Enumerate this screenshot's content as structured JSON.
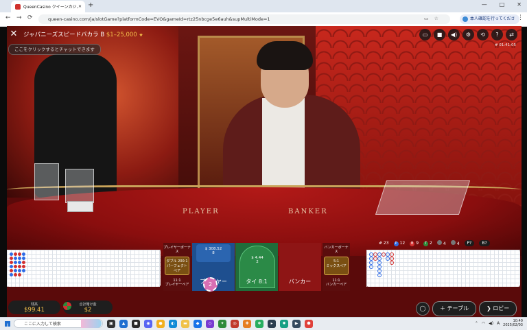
{
  "browser": {
    "tab_title": "QueenCasino クイーンカジノ |",
    "tab_close": "✕",
    "new_tab": "+",
    "url": "queen-casino.com/ja/slotGame?platformCode=EVO&gameId=rtz25nbcge5e6auh&supMultiMode=1",
    "profile_label": "本人確認を行ってくださ",
    "window_controls": [
      "—",
      "□",
      "✕"
    ],
    "nav": [
      "←",
      "→",
      "⟳"
    ]
  },
  "game": {
    "close_icon": "✕",
    "title": "ジャパニーズスピードバカラ B",
    "limits": "$1–25,000",
    "star": "★",
    "chat_placeholder": "ここをクリックするとチャットできます",
    "game_id": "# 01:41:05",
    "top_icons": [
      "chat-icon",
      "camera-icon",
      "volume-icon",
      "settings-icon",
      "history-icon",
      "help-icon",
      "lobby-switch-icon"
    ],
    "top_icon_glyphs": [
      "▭",
      "■",
      "◀)",
      "⚙",
      "⟲",
      "?",
      "⇄"
    ],
    "table_labels": {
      "player": "PLAYER",
      "banker": "BANKER"
    }
  },
  "stats": {
    "total": "# 23",
    "player": "12",
    "banker": "9",
    "tie": "2",
    "player_pair": "4",
    "banker_pair": "4",
    "p_label": "P",
    "b_label": "B",
    "t_label": "T",
    "pp_label": "P?",
    "bb_label": "B?"
  },
  "bets": {
    "player_bonus": "プレイヤーボーナス",
    "perfect_pair_odds": "ダブル 200:1",
    "perfect_pair": "パーフェクトペア",
    "player_pair_odds": "11:1",
    "player_pair": "プレイヤーペア",
    "player_amount": "$ 308.52",
    "player_count": "8",
    "player": "プレイヤー",
    "tie_amount": "$ 4.44",
    "tie_count": "2",
    "tie": "タイ 8:1",
    "banker": "バンカー",
    "banker_bonus": "バンカーボーナス",
    "either_pair_odds": "5:1",
    "either_pair": "ミックスペア",
    "banker_pair_odds": "11:1",
    "banker_pair": "バンカーペア",
    "chip_value": "2"
  },
  "footer": {
    "balance_label": "残高",
    "balance": "$99.41",
    "total_bet_label": "合計賭け金",
    "total_bet": "$2",
    "table_button": "＋ テーブル",
    "lobby_button": "ロビー",
    "lobby_icon": "❯"
  },
  "taskbar": {
    "search_placeholder": "ここに入力して検索",
    "time": "10:40",
    "date": "2025/02/03",
    "lang": "A"
  }
}
